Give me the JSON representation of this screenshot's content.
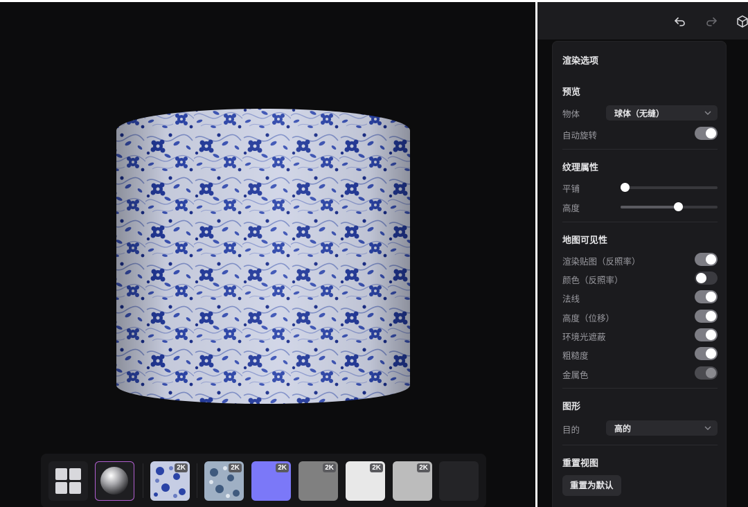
{
  "toolbar": {
    "undo_icon": "undo-icon",
    "redo_icon": "redo-icon",
    "cube_icon": "cube-icon"
  },
  "panel": {
    "title": "渲染选项",
    "preview": {
      "heading": "预览",
      "object_label": "物体",
      "object_value": "球体（无缝）",
      "auto_rotate_label": "自动旋转",
      "auto_rotate": true
    },
    "texture": {
      "heading": "纹理属性",
      "tiling_label": "平铺",
      "tiling_value": 0.04,
      "height_label": "高度",
      "height_value": 0.59
    },
    "map_visibility": {
      "heading": "地图可见性",
      "items": [
        {
          "label": "渲染贴图（反照率）",
          "state": "on"
        },
        {
          "label": "颜色（反照率）",
          "state": "off"
        },
        {
          "label": "法线",
          "state": "on"
        },
        {
          "label": "高度（位移）",
          "state": "on"
        },
        {
          "label": "环境光遮蔽",
          "state": "on"
        },
        {
          "label": "粗糙度",
          "state": "on"
        },
        {
          "label": "金属色",
          "state": "disabled"
        }
      ]
    },
    "shape": {
      "heading": "图形",
      "purpose_label": "目的",
      "purpose_value": "高的"
    },
    "reset": {
      "heading": "重置视图",
      "button_label": "重置为默认"
    }
  },
  "thumbnails": [
    {
      "kind": "grid-view",
      "icon": "grid-icon"
    },
    {
      "kind": "sphere-preview",
      "icon": "sphere-icon",
      "selected": true
    },
    {
      "kind": "render-map",
      "badge": "2K",
      "color": "#5a6fb8"
    },
    {
      "kind": "color-map",
      "badge": "2K",
      "color": "#6e86a0"
    },
    {
      "kind": "normal-map",
      "badge": "2K",
      "color": "#7b78f8"
    },
    {
      "kind": "height-map",
      "badge": "2K",
      "color": "#808080"
    },
    {
      "kind": "ao-map",
      "badge": "2K",
      "color": "#e8e8e8"
    },
    {
      "kind": "roughness-map",
      "badge": "2K",
      "color": "#bcbcbc"
    },
    {
      "kind": "metal-map",
      "color": "#242427"
    }
  ],
  "colors": {
    "accent_selected": "#b15fd0",
    "background": "#0c0c0d",
    "panel": "#1b1b1e"
  }
}
